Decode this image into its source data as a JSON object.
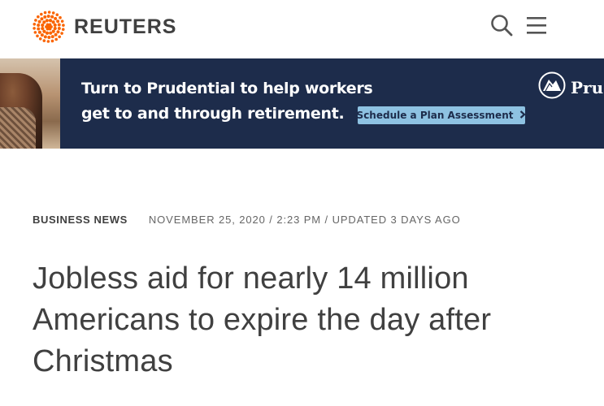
{
  "header": {
    "brand": "REUTERS",
    "logo_icon": "reuters-dots-logo",
    "accent_color": "#fa6400",
    "search_icon": "search-icon",
    "menu_icon": "hamburger-menu-icon"
  },
  "ad": {
    "line1": "Turn to Prudential to help workers",
    "line2": "get to and through retirement.",
    "cta": "Schedule a Plan Assessment",
    "brand": "Prud",
    "background": "#1d2c4b",
    "cta_color": "#8ec2e2"
  },
  "article": {
    "section": "BUSINESS NEWS",
    "dateline": "NOVEMBER 25, 2020 / 2:23 PM / UPDATED 3 DAYS AGO",
    "headline": "Jobless aid for nearly 14 million Americans to expire the day after Christmas"
  }
}
